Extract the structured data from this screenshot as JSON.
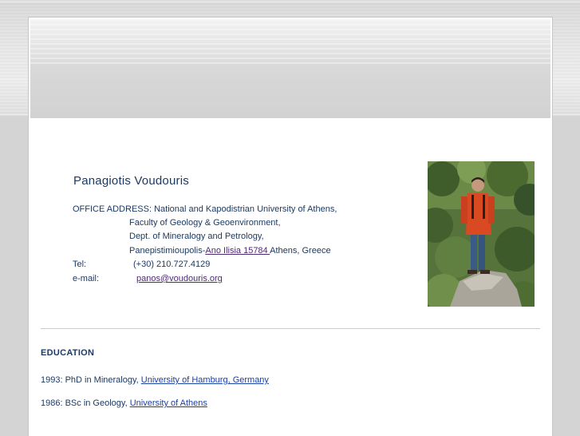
{
  "profile": {
    "name": "Panagiotis Voudouris",
    "office_label": "OFFICE ADDRESS: National and Kapodistrian University of Athens,",
    "address_lines": [
      "Faculty of Geology & Geoenvironment,",
      "Dept. of Mineralogy and Petrology,"
    ],
    "address_last_prefix": "Panepistimioupolis-",
    "address_last_link": "Ano Ilisia 15784 ",
    "address_last_suffix": "Athens, Greece",
    "tel_label": "Tel:",
    "tel_value": "(+30) 210.727.4129",
    "email_label": "e-mail:",
    "email_value": "panos@voudouris.org"
  },
  "education": {
    "heading": "EDUCATION",
    "items": [
      {
        "prefix": "1993: PhD in Mineralogy, ",
        "link": "University of Hamburg, Germany "
      },
      {
        "prefix": "1986: BSc in Geology, ",
        "link": "University of Athens "
      }
    ]
  },
  "colors": {
    "text": "#1d3a63",
    "visited_link": "#4d2a74",
    "link": "#1a3fa8"
  }
}
